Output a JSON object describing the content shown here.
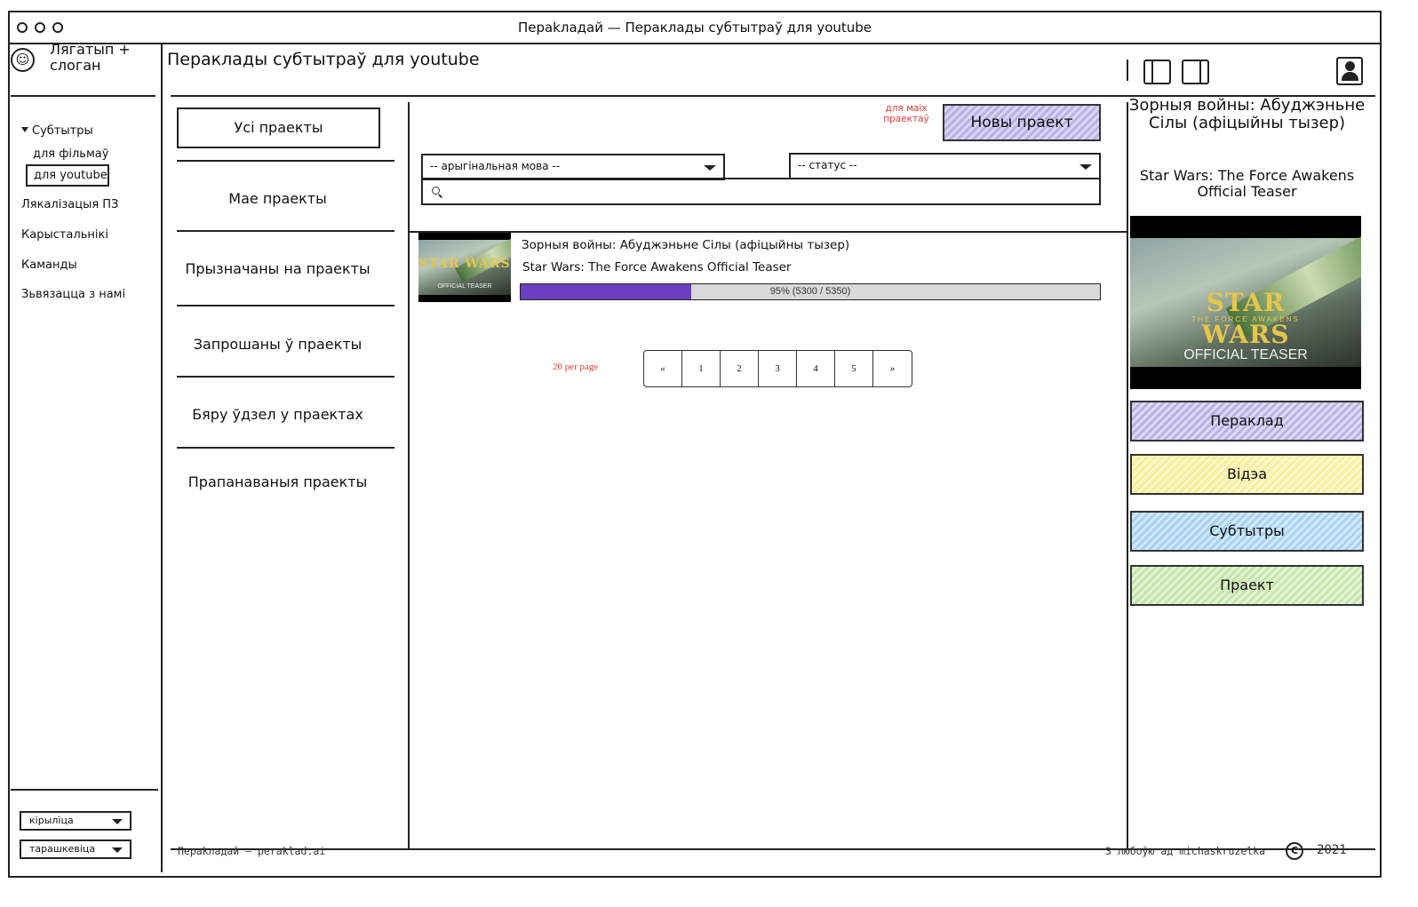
{
  "window": {
    "title": "Пераkладай — Пераклады субтытраў для youtube"
  },
  "brand": {
    "logo_icon": "smiley-icon",
    "text": "Лягатып + слоган"
  },
  "sidebar": {
    "group_label": "Субтытры",
    "sub_items": [
      "для фільмаў",
      "для youtube"
    ],
    "items": [
      "Лякалізацыя ПЗ",
      "Карыстальнікі",
      "Каманды",
      "Зьвязацца з намі"
    ],
    "script_select": "кірыліца",
    "orthography_select": "тарашкевіца"
  },
  "header": {
    "title": "Пераклады субтытраў для youtube",
    "icons": [
      "left-panel-icon",
      "right-panel-icon",
      "user-profile-icon"
    ]
  },
  "projects_nav": {
    "items": [
      "Усі праекты",
      "Мае праекты",
      "Прызначаны на праекты",
      "Запрошаны ў праекты",
      "Бяру ўдзел у праектах",
      "Прапанаваныя праекты"
    ]
  },
  "toolbar": {
    "note": "для маіх праектаў",
    "new_project": "Новы праект",
    "language_filter": "-- арыгінальная мова --",
    "status_filter": "-- статус --",
    "search_placeholder": ""
  },
  "projects": [
    {
      "title": "Зорныя войны: Абуджэньне Сілы (афіцыйны тызер)",
      "subtitle": "Star Wars: The Force Awakens Official Teaser",
      "progress": 0.295,
      "progress_label": "95% (5300 / 5350)",
      "thumb_logo": "STAR WARS",
      "thumb_caption": "OFFICIAL TEASER"
    }
  ],
  "pagination": {
    "per_page": "20 per page",
    "pages": [
      "«",
      "1",
      "2",
      "3",
      "4",
      "5",
      "»"
    ]
  },
  "detail": {
    "title": "Зорныя войны: Абуджэньне Сілы (афіцыйны тызер)",
    "subtitle": "Star Wars: The Force Awakens Official Teaser",
    "video_logo_top": "STAR",
    "video_logo_mid": "THE FORCE AWAKENS",
    "video_logo_bottom": "WARS",
    "video_caption": "OFFICIAL TEASER",
    "buttons": [
      {
        "label": "Пераклад",
        "color": "#b7b3e6"
      },
      {
        "label": "Відэа",
        "color": "#f7ef9c"
      },
      {
        "label": "Субтытры",
        "color": "#a8d2f3"
      },
      {
        "label": "Праект",
        "color": "#c3e6a6"
      }
    ]
  },
  "footer": {
    "left": "Пераkладай — peraklad.ai",
    "right": "З любоўю ад michaskruzelka",
    "copyright_symbol": "C",
    "year": "2021"
  }
}
